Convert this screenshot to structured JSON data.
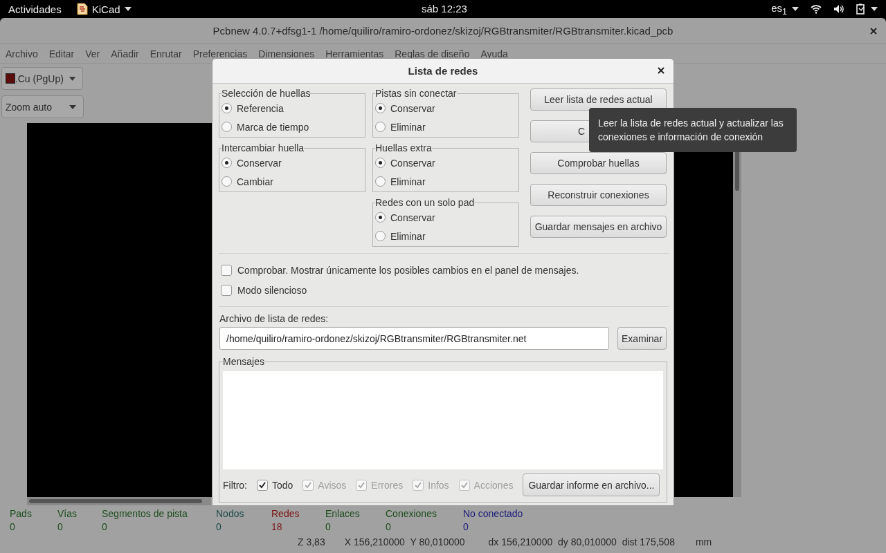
{
  "top_bar": {
    "activities": "Actividades",
    "app": "KiCad",
    "clock": "sáb 12:23",
    "keyboard": "es$_{1}$"
  },
  "window": {
    "title": "Pcbnew 4.0.7+dfsg1-1 /home/quiliro/ramiro-ordonez/skizoj/RGBtransmiter/RGBtransmiter.kicad_pcb"
  },
  "menu": [
    "Archivo",
    "Editar",
    "Ver",
    "Añadir",
    "Enrutar",
    "Preferencias",
    "Dimensiones",
    "Herramientas",
    "Reglas de diseño",
    "Ayuda"
  ],
  "toolbar": {
    "layer": ".Cu (PgUp)",
    "zoom": "Zoom auto"
  },
  "status": {
    "stats": [
      {
        "label": "Pads",
        "value": "0",
        "color": "#1e4d1e"
      },
      {
        "label": "Vías",
        "value": "0",
        "color": "#1e4d1e"
      },
      {
        "label": "Segmentos de pista",
        "value": "0",
        "color": "#1e4d1e"
      },
      {
        "label": "Nodos",
        "value": "0",
        "color": "#1e4a4a"
      },
      {
        "label": "Redes",
        "value": "18",
        "color": "#7a1414"
      },
      {
        "label": "Enlaces",
        "value": "0",
        "color": "#1e4d1e"
      },
      {
        "label": "Conexiones",
        "value": "0",
        "color": "#1e4d1e"
      },
      {
        "label": "No conectado",
        "value": "0",
        "color": "#1a1a7a"
      }
    ],
    "coords": [
      "Z 3,83",
      "X 156,210000  Y 80,010000",
      "dx 156,210000  dy 80,010000  dist 175,508",
      "mm"
    ]
  },
  "dialog": {
    "title": "Lista de redes",
    "groups": [
      {
        "title": "Selección de huellas",
        "options": [
          {
            "label": "Referencia",
            "selected": true
          },
          {
            "label": "Marca de tiempo",
            "selected": false
          }
        ]
      },
      {
        "title": "Pistas sin conectar",
        "options": [
          {
            "label": "Conservar",
            "selected": true
          },
          {
            "label": "Eliminar",
            "selected": false
          }
        ]
      },
      {
        "title": "Intercambiar huella",
        "options": [
          {
            "label": "Conservar",
            "selected": true
          },
          {
            "label": "Cambiar",
            "selected": false
          }
        ]
      },
      {
        "title": "Huellas extra",
        "options": [
          {
            "label": "Conservar",
            "selected": true
          },
          {
            "label": "Eliminar",
            "selected": false
          }
        ]
      },
      {
        "title": "Redes con un solo pad",
        "options": [
          {
            "label": "Conservar",
            "selected": true
          },
          {
            "label": "Eliminar",
            "selected": false
          }
        ]
      }
    ],
    "buttons": [
      "Leer lista de redes actual",
      "C",
      "Comprobar huellas",
      "Reconstruir conexiones",
      "Guardar mensajes en archivo"
    ],
    "options": [
      {
        "label": "Comprobar. Mostrar únicamente los posibles cambios en el panel de mensajes.",
        "checked": false
      },
      {
        "label": "Modo silencioso",
        "checked": false
      }
    ],
    "file_label": "Archivo de lista de redes:",
    "file_value": "/home/quiliro/ramiro-ordonez/skizoj/RGBtransmiter/RGBtransmiter.net",
    "browse": "Examinar",
    "messages_title": "Mensajes",
    "filter_label": "Filtro:",
    "filters": [
      {
        "label": "Todo",
        "checked": true,
        "disabled": false
      },
      {
        "label": "Avisos",
        "checked": true,
        "disabled": true
      },
      {
        "label": "Errores",
        "checked": true,
        "disabled": true
      },
      {
        "label": "Infos",
        "checked": true,
        "disabled": true
      },
      {
        "label": "Acciones",
        "checked": true,
        "disabled": true
      }
    ],
    "save_report": "Guardar informe en archivo..."
  },
  "tooltip": "Leer la lista de redes actual y actualizar las conexiones e información de conexión"
}
